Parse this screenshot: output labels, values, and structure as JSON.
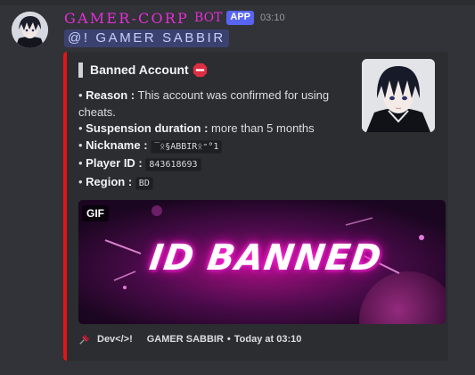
{
  "message": {
    "author": "GAMER-CORP",
    "bot_tag": "BOT",
    "app_badge": "APP",
    "time": "03:10",
    "mention": "@!  GAMER SABBIR"
  },
  "embed": {
    "accent_color": "#e31515",
    "title": "Banned Account",
    "title_icon": "stop-sign-icon",
    "fields": [
      {
        "label": "Reason :",
        "value": "This account was confirmed for using cheats."
      },
      {
        "label": "Suspension duration :",
        "value": "more than 5 months"
      },
      {
        "label": "Nickname :",
        "value": "‾ᛟ§ABBIRᛟ⁼°1"
      },
      {
        "label": "Player ID :",
        "value": "843618693"
      },
      {
        "label": "Region :",
        "value": "BD"
      }
    ],
    "gif_badge": "GIF",
    "gif_text": "ID BANNED",
    "footer": {
      "icon": "pushpin-icon",
      "source": "Dev</>!",
      "user": "GAMER SABBIR",
      "time": "Today at 03:10"
    }
  }
}
